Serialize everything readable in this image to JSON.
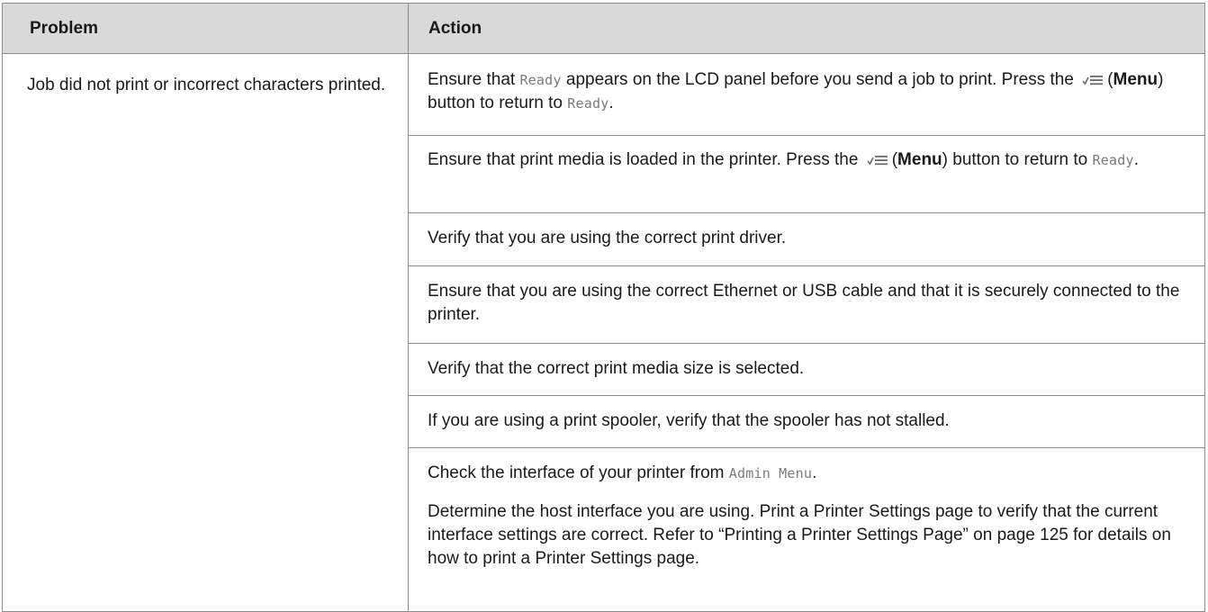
{
  "table": {
    "headers": {
      "problem": "Problem",
      "action": "Action"
    },
    "problem_text": "Job did not print or incorrect characters printed.",
    "actions": {
      "a1": {
        "part1": "Ensure that ",
        "lcd1": "Ready",
        "part2": " appears on the LCD panel before you send a job to print. Press the ",
        "menu_open": "(",
        "menu_word": "Menu",
        "menu_close": ")",
        "part3": " button to return to ",
        "lcd2": "Ready",
        "part4": "."
      },
      "a2": {
        "part1": "Ensure that print media is loaded in the printer. Press the ",
        "menu_open": "(",
        "menu_word": "Menu",
        "menu_close": ")",
        "part2": " button to return to ",
        "lcd": "Ready",
        "part3": "."
      },
      "a3": "Verify that you are using the correct print driver.",
      "a4": "Ensure that you are using the correct Ethernet or USB cable and that it is securely connected to the printer.",
      "a5": "Verify that the correct print media size is selected.",
      "a6": "If you are using a print spooler, verify that the spooler has not stalled.",
      "a7": {
        "part1": "Check the interface of your printer from ",
        "lcd": "Admin Menu",
        "part2": ".",
        "para2": "Determine the host interface you are using. Print a Printer Settings page to verify that the current interface settings are correct. Refer to “Printing a Printer Settings Page” on page 125 for details on how to print a Printer Settings page."
      }
    }
  },
  "icons": {
    "menu": "menu-list-icon"
  }
}
